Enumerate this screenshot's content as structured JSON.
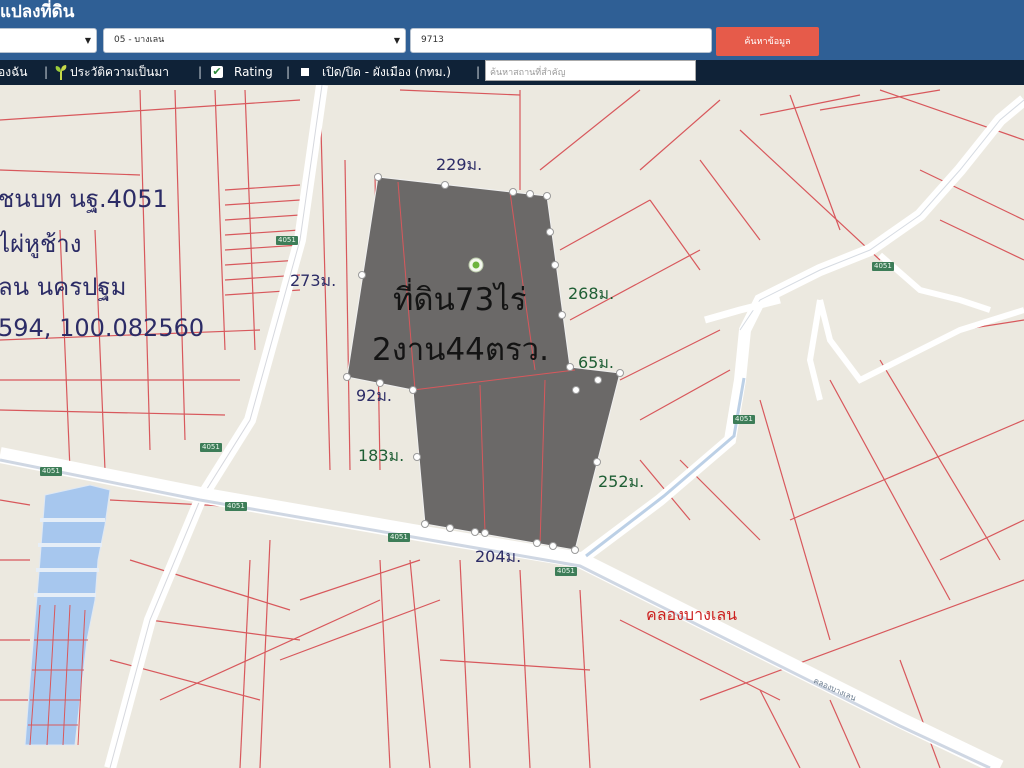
{
  "header": {
    "title": "แปลงที่ดิน",
    "province_select_value": "",
    "district_select_value": "05 - บางเลน",
    "parcel_number_value": "9713",
    "search_button_label": "ค้นหาข้อมูล"
  },
  "toolbar": {
    "item1_label": "องฉัน",
    "history_label": "ประวัติความเป็นมา",
    "rating_label": "Rating",
    "city_plan_label": "เปิด/ปิด - ผังเมือง (กทม.)",
    "place_search_placeholder": "ค้นหาสถานที่สำคัญ",
    "separator": "|"
  },
  "map": {
    "location_info": [
      "ชนบท นฐ.4051",
      "ไผ่หูช้าง",
      "ลน นครปฐม",
      "594, 100.082560"
    ],
    "area_label_line1": "ที่ดิน73ไร่",
    "area_label_line2": "2งาน44ตรว.",
    "dimensions": [
      {
        "id": "top",
        "text": "229ม."
      },
      {
        "id": "left-upper",
        "text": "273ม."
      },
      {
        "id": "right-upper",
        "text": "268ม."
      },
      {
        "id": "right-notch",
        "text": "65ม."
      },
      {
        "id": "left-notch",
        "text": "92ม."
      },
      {
        "id": "left-lower",
        "text": "183ม."
      },
      {
        "id": "right-lower",
        "text": "252ม."
      },
      {
        "id": "bottom",
        "text": "204ม."
      }
    ],
    "canal_label": "คลองบางเลน",
    "canal_label_small": "คลองบางเลน",
    "road_shields": [
      "4051",
      "4051",
      "4051",
      "4051",
      "4051",
      "4051",
      "4051",
      "4051"
    ],
    "parcel_fill_color": "#6b6968",
    "parcel_edge_color": "#ffffff",
    "boundary_line_color": "#d8585c",
    "road_color": "#ffffff",
    "pin_icon": "map-pin-icon"
  }
}
